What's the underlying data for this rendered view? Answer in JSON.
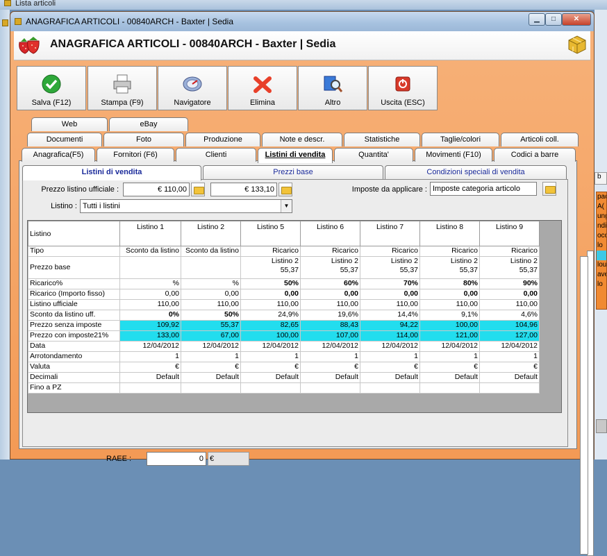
{
  "bg_window": {
    "title": "Lista articoli"
  },
  "bg_right": {
    "grid_letter": "b",
    "list_items": [
      "pac",
      "A(",
      "ung",
      "ndi",
      "occ",
      "lo",
      "",
      "lou",
      "ave",
      "lo",
      "",
      ""
    ]
  },
  "window": {
    "title": "ANAGRAFICA ARTICOLI - 00840ARCH - Baxter | Sedia",
    "header_title": "ANAGRAFICA ARTICOLI - 00840ARCH - Baxter | Sedia"
  },
  "toolbar": {
    "buttons": [
      {
        "label": "Salva (F12)",
        "icon": "check-icon"
      },
      {
        "label": "Stampa (F9)",
        "icon": "printer-icon"
      },
      {
        "label": "Navigatore",
        "icon": "compass-icon"
      },
      {
        "label": "Elimina",
        "icon": "delete-icon"
      },
      {
        "label": "Altro",
        "icon": "magnifier-icon"
      },
      {
        "label": "Uscita (ESC)",
        "icon": "exit-icon"
      }
    ]
  },
  "tabs": {
    "row1": [
      "Web",
      "eBay"
    ],
    "row2": [
      "Documenti",
      "Foto",
      "Produzione",
      "Note e descr.",
      "Statistiche",
      "Taglie/colori",
      "Articoli coll."
    ],
    "row3": [
      "Anagrafica(F5)",
      "Fornitori (F6)",
      "Clienti",
      "Listini di vendita",
      "Quantita'",
      "Movimenti (F10)",
      "Codici a barre"
    ]
  },
  "subtabs": [
    "Listini di vendita",
    "Prezzi base",
    "Condizioni speciali di vendita"
  ],
  "form": {
    "prezzo_label": "Prezzo listino ufficiale :",
    "prezzo_value": "€ 110,00",
    "prezzo_value2": "€ 133,10",
    "imposte_label": "Imposte da applicare :",
    "imposte_value": "Imposte categoria articolo",
    "listino_label": "Listino :",
    "listino_value": "Tutti i listini"
  },
  "grid": {
    "corner": "Listino",
    "columns": [
      "Listino 1",
      "Listino 2",
      "Listino 5",
      "Listino 6",
      "Listino 7",
      "Listino 8",
      "Listino 9"
    ],
    "rows": [
      {
        "label": "Tipo",
        "values": [
          "Sconto da listino",
          "Sconto da listino",
          "Ricarico",
          "Ricarico",
          "Ricarico",
          "Ricarico",
          "Ricarico"
        ]
      },
      {
        "label": "Prezzo base",
        "values": [
          "",
          "",
          "Listino 2\n55,37",
          "Listino 2\n55,37",
          "Listino 2\n55,37",
          "Listino 2\n55,37",
          "Listino 2\n55,37"
        ]
      },
      {
        "label": "Ricarico%",
        "values": [
          "%",
          "%",
          "50%",
          "60%",
          "70%",
          "80%",
          "90%"
        ]
      },
      {
        "label": "Ricarico (Importo fisso)",
        "values": [
          "0,00",
          "0,00",
          "0,00",
          "0,00",
          "0,00",
          "0,00",
          "0,00"
        ]
      },
      {
        "label": "Listino ufficiale",
        "values": [
          "110,00",
          "110,00",
          "110,00",
          "110,00",
          "110,00",
          "110,00",
          "110,00"
        ]
      },
      {
        "label": "Sconto da listino uff.",
        "values": [
          "0%",
          "50%",
          "24,9%",
          "19,6%",
          "14,4%",
          "9,1%",
          "4,6%"
        ]
      },
      {
        "label": "Prezzo senza imposte",
        "values": [
          "109,92",
          "55,37",
          "82,65",
          "88,43",
          "94,22",
          "100,00",
          "104,96"
        ]
      },
      {
        "label": "Prezzo con imposte21%",
        "values": [
          "133,00",
          "67,00",
          "100,00",
          "107,00",
          "114,00",
          "121,00",
          "127,00"
        ]
      },
      {
        "label": "Data",
        "values": [
          "12/04/2012",
          "12/04/2012",
          "12/04/2012",
          "12/04/2012",
          "12/04/2012",
          "12/04/2012",
          "12/04/2012"
        ]
      },
      {
        "label": "Arrotondamento",
        "values": [
          "1",
          "1",
          "1",
          "1",
          "1",
          "1",
          "1"
        ]
      },
      {
        "label": "Valuta",
        "values": [
          "€",
          "€",
          "€",
          "€",
          "€",
          "€",
          "€"
        ]
      },
      {
        "label": "Decimali",
        "values": [
          "Default",
          "Default",
          "Default",
          "Default",
          "Default",
          "Default",
          "Default"
        ]
      },
      {
        "label": "Fino a PZ",
        "values": [
          "",
          "",
          "",
          "",
          "",
          "",
          ""
        ]
      }
    ]
  },
  "raee": {
    "label": "RAEE :",
    "value": "0",
    "currency": "€"
  },
  "colors": {
    "window_bg": "#f39a55",
    "highlight": "#22ddee",
    "accent_tab_text": "#1a2a9a"
  }
}
